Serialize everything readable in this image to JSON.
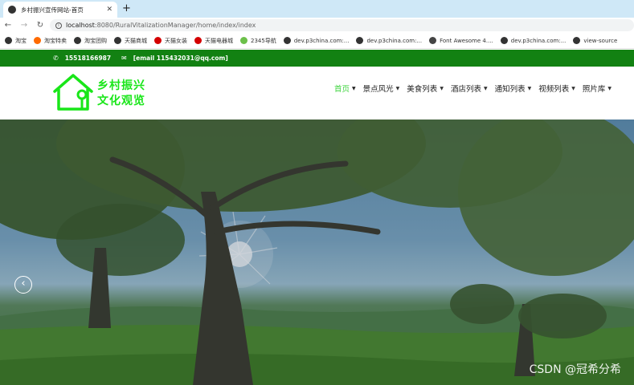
{
  "browser": {
    "tab_title": "乡村振兴宣传网站-首页",
    "new_tab_label": "+",
    "url_host": "localhost",
    "url_path": ":8080/RuralVitalizationManager/home/index/index",
    "bookmarks": [
      {
        "label": "淘宝",
        "color": "#333333"
      },
      {
        "label": "淘宝特卖",
        "color": "#ff6a00"
      },
      {
        "label": "淘宝团购",
        "color": "#333333"
      },
      {
        "label": "天猫商城",
        "color": "#333333"
      },
      {
        "label": "天猫女装",
        "color": "#d40000"
      },
      {
        "label": "天猫电器城",
        "color": "#d40000"
      },
      {
        "label": "2345导航",
        "color": "#6cc04a"
      },
      {
        "label": "dev.p3china.com:...",
        "color": "#333333"
      },
      {
        "label": "dev.p3china.com:...",
        "color": "#333333"
      },
      {
        "label": "Font Awesome 4....",
        "color": "#444444"
      },
      {
        "label": "dev.p3china.com:...",
        "color": "#333333"
      },
      {
        "label": "view-source",
        "color": "#333333"
      }
    ]
  },
  "topbar": {
    "phone": "15518166987",
    "email": "[email 115432031@qq.com]",
    "bg_color": "#128112"
  },
  "header": {
    "logo_line1": "乡村振兴",
    "logo_line2": "文化观览",
    "logo_color": "#19e619",
    "menu": [
      {
        "label": "首页",
        "active": true
      },
      {
        "label": "景点风光",
        "active": false
      },
      {
        "label": "美食列表",
        "active": false
      },
      {
        "label": "酒店列表",
        "active": false
      },
      {
        "label": "通知列表",
        "active": false
      },
      {
        "label": "视频列表",
        "active": false
      },
      {
        "label": "照片库",
        "active": false
      }
    ]
  },
  "hero": {
    "watermark": "CSDN @冠希分希"
  }
}
